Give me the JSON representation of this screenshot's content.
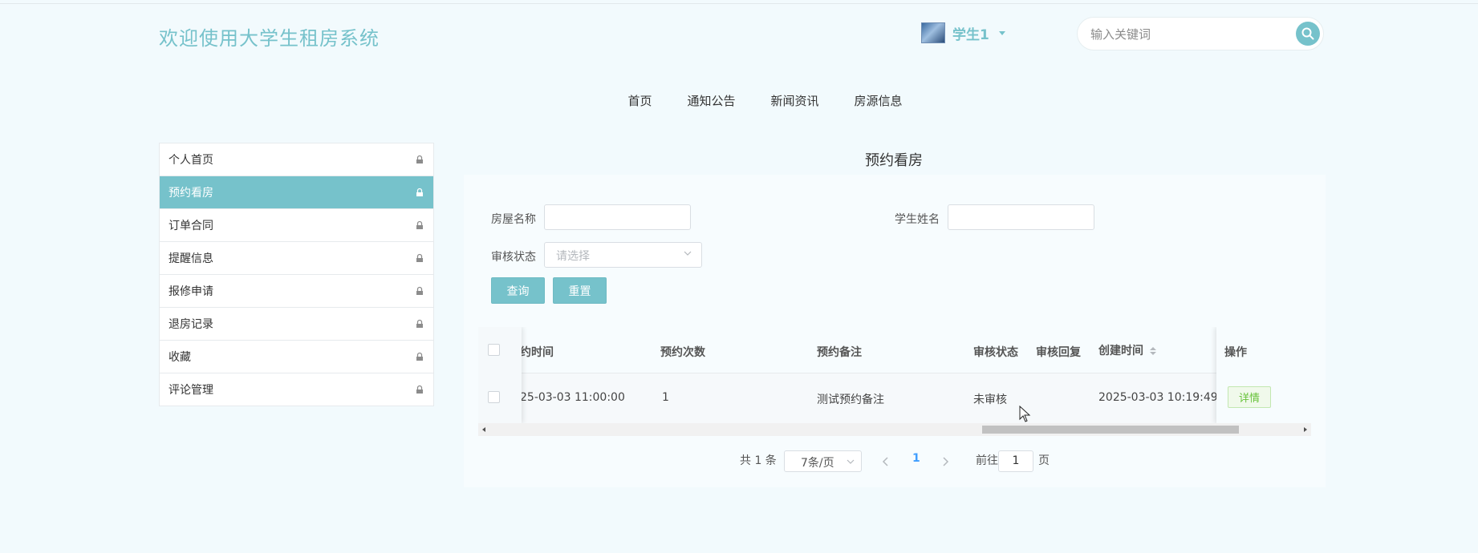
{
  "header": {
    "site_title": "欢迎使用大学生租房系统",
    "user_name": "学生1",
    "search_placeholder": "输入关键词"
  },
  "nav": [
    "首页",
    "通知公告",
    "新闻资讯",
    "房源信息"
  ],
  "sidebar": {
    "items": [
      {
        "label": "个人首页"
      },
      {
        "label": "预约看房",
        "active": true
      },
      {
        "label": "订单合同"
      },
      {
        "label": "提醒信息"
      },
      {
        "label": "报修申请"
      },
      {
        "label": "退房记录"
      },
      {
        "label": "收藏"
      },
      {
        "label": "评论管理"
      }
    ]
  },
  "page": {
    "title": "预约看房",
    "filters": {
      "house_name_label": "房屋名称",
      "student_name_label": "学生姓名",
      "status_label": "审核状态",
      "status_placeholder": "请选择"
    },
    "buttons": {
      "query": "查询",
      "reset": "重置"
    },
    "table": {
      "headers": [
        "约时间",
        "预约次数",
        "预约备注",
        "审核状态",
        "审核回复",
        "创建时间",
        "操作"
      ],
      "rows": [
        {
          "time": "25-03-03 11:00:00",
          "count": "1",
          "remark": "测试预约备注",
          "status": "未审核",
          "reply": "",
          "created": "2025-03-03 10:19:49",
          "action": "详情"
        }
      ]
    },
    "pagination": {
      "total": "共 1 条",
      "page_size": "7条/页",
      "current": "1",
      "goto_prefix": "前往",
      "goto_value": "1",
      "goto_suffix": "页"
    }
  },
  "colors": {
    "accent": "#76c2cb",
    "success": "#67c23a",
    "background": "#f2fafd"
  }
}
